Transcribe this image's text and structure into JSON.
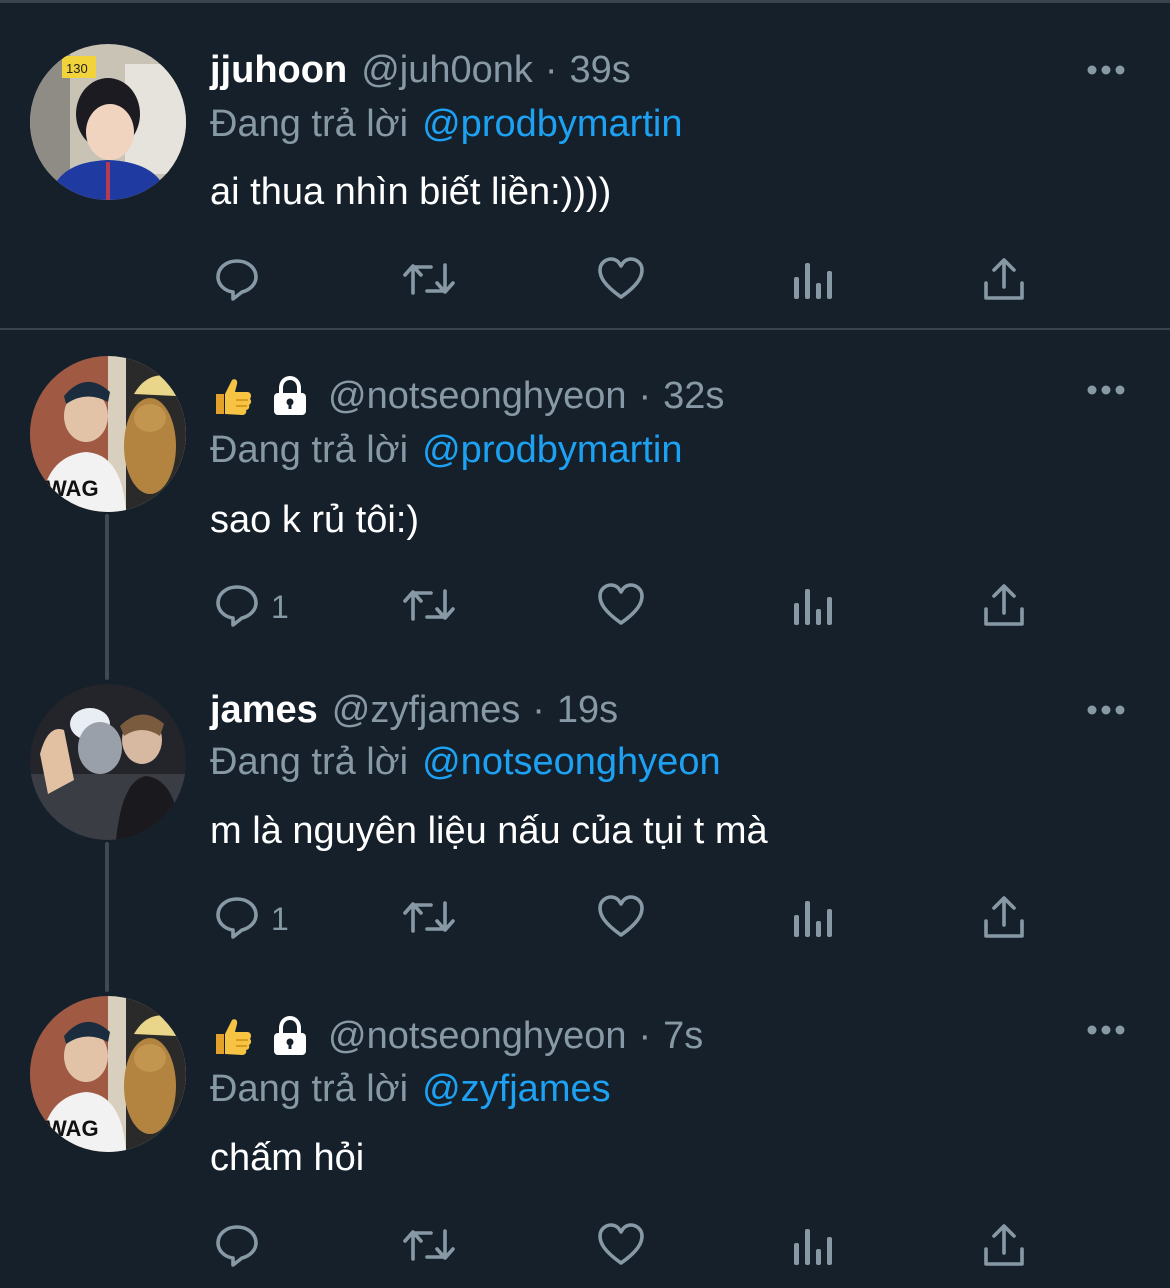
{
  "tweets": [
    {
      "name": "jjuhoon",
      "handle": "@juh0onk",
      "time": "39s",
      "reply_prefix": "Đang trả lời",
      "reply_to": "@prodbymartin",
      "text": "ai thua nhìn biết liền:))))",
      "reply_count": "",
      "avatar_icon": "user-photo-avatar"
    },
    {
      "name": "",
      "name_emoji": "👍",
      "protected": true,
      "handle": "@notseonghyeon",
      "time": "32s",
      "reply_prefix": "Đang trả lời",
      "reply_to": "@prodbymartin",
      "text": "sao k rủ tôi:)",
      "reply_count": "1",
      "avatar_icon": "user-photo-avatar"
    },
    {
      "name": "james",
      "handle": "@zyfjames",
      "time": "19s",
      "reply_prefix": "Đang trả lời",
      "reply_to": "@notseonghyeon",
      "text": "m là nguyên liệu nấu của tụi t mà",
      "reply_count": "1",
      "avatar_icon": "user-photo-avatar"
    },
    {
      "name": "",
      "name_emoji": "👍",
      "protected": true,
      "handle": "@notseonghyeon",
      "time": "7s",
      "reply_prefix": "Đang trả lời",
      "reply_to": "@zyfjames",
      "text": "chấm hỏi",
      "reply_count": "",
      "avatar_icon": "user-photo-avatar"
    }
  ],
  "separator": "·",
  "actions": [
    "reply-icon",
    "retweet-icon",
    "like-icon",
    "analytics-icon",
    "share-icon"
  ],
  "colors": {
    "background": "#15202b",
    "secondary_text": "#8899a6",
    "link": "#1da1f2",
    "divider": "#38444d"
  }
}
